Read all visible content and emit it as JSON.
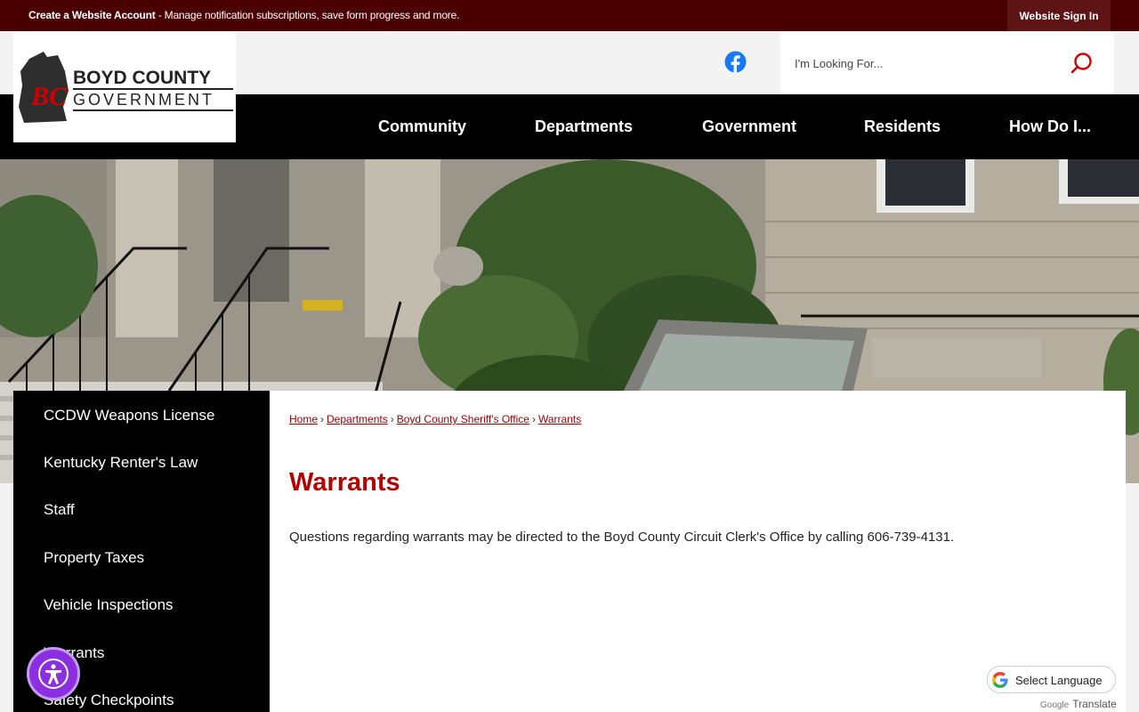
{
  "topbar": {
    "create_account": "Create a Website Account",
    "message": " - Manage notification subscriptions, save form progress and more.",
    "signin": "Website Sign In"
  },
  "logo": {
    "line1": "BOYD COUNTY",
    "line2": "GOVERNMENT",
    "mark": "BC"
  },
  "search": {
    "placeholder": "I'm Looking For..."
  },
  "nav": {
    "items": [
      "Community",
      "Departments",
      "Government",
      "Residents",
      "How Do I..."
    ]
  },
  "sidebar": {
    "items": [
      "CCDW Weapons License",
      "Kentucky Renter's Law",
      "Staff",
      "Property Taxes",
      "Vehicle Inspections",
      "Warrants",
      "Safety Checkpoints"
    ]
  },
  "breadcrumb": [
    "Home",
    "Departments",
    "Boyd County Sheriff's Office",
    "Warrants"
  ],
  "page": {
    "title": "Warrants",
    "text": "Questions regarding warrants may be directed to the Boyd County Circuit Clerk's Office by calling 606-739-4131."
  },
  "translate": {
    "label": "Select Language",
    "powered_google": "Google",
    "powered_translate": "Translate"
  },
  "colors": {
    "topbar": "#4a0000",
    "accent_red": "#b60000",
    "nav": "#000000",
    "a11y": "#8b2fe0"
  }
}
